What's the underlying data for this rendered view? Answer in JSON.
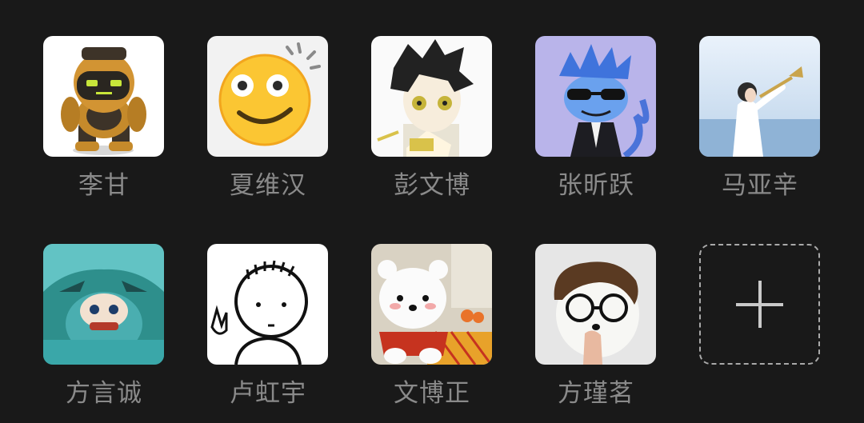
{
  "members": [
    {
      "name": "李甘",
      "avatar": "robot-avatar"
    },
    {
      "name": "夏维汉",
      "avatar": "smiley-emoji-avatar"
    },
    {
      "name": "彭文博",
      "avatar": "anime-boy-avatar"
    },
    {
      "name": "张昕跃",
      "avatar": "blue-dragon-avatar"
    },
    {
      "name": "马亚辛",
      "avatar": "trumpet-player-avatar"
    },
    {
      "name": "方言诚",
      "avatar": "teal-plush-doll-avatar"
    },
    {
      "name": "卢虹宇",
      "avatar": "doodle-boy-avatar"
    },
    {
      "name": "文博正",
      "avatar": "white-bear-plush-avatar"
    },
    {
      "name": "方瑾茗",
      "avatar": "glasses-plush-avatar"
    }
  ],
  "add_button": {
    "icon": "plus-icon"
  }
}
